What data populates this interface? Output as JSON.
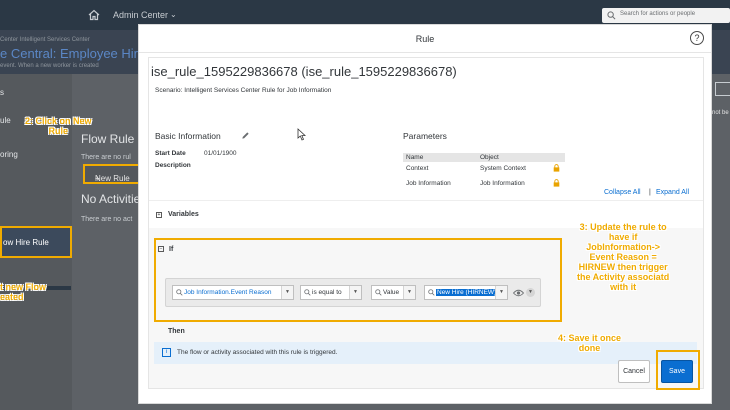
{
  "app": {
    "title": "Admin Center",
    "search_placeholder": "Search for actions or people",
    "breadcrumb": "Center Intelligent Services Center",
    "page_title": "e Central: Employee Hire",
    "subtitle": "event. When a new worker is created"
  },
  "sidebar": {
    "items": [
      "s",
      "ule",
      "oring",
      "ow Hire Rule"
    ]
  },
  "content": {
    "flow_rule_title": "Flow Rule",
    "no_rules_text": "There are no rul",
    "new_rule_button": "New Rule",
    "no_activities_title": "No Activitie",
    "no_activities_text": "There are no act",
    "right_cut_text": "not be"
  },
  "callouts": {
    "step2": "2: Click on New\nRule",
    "step1": "t new Flow\neated",
    "step3": "3: Update the rule to\nhave if\nJobInformation->\nEvent Reason =\nHIRNEW then trigger\nthe Activity associatd\nwith it",
    "step4": "4: Save it once\ndone"
  },
  "dialog": {
    "title": "Rule",
    "help": "?",
    "rule_title": "ise_rule_1595229836678 (ise_rule_1595229836678)",
    "scenario": "Scenario: Intelligent Services Center Rule for Job Information",
    "basic_info": {
      "title": "Basic Information",
      "start_date_label": "Start Date",
      "start_date_value": "01/01/1900",
      "description_label": "Description"
    },
    "parameters": {
      "title": "Parameters",
      "col_name": "Name",
      "col_object": "Object",
      "rows": [
        {
          "name": "Context",
          "object": "System Context"
        },
        {
          "name": "Job Information",
          "object": "Job Information"
        }
      ]
    },
    "collapse_all": "Collapse All",
    "expand_all": "Expand All",
    "link_separator": "|",
    "variables_label": "Variables",
    "if_label": "If",
    "condition": {
      "field": "Job Information.Event Reason",
      "operator": "is equal to",
      "value_type": "Value",
      "value": "New Hire (HIRNEW)"
    },
    "then_label": "Then",
    "message": "The flow or activity associated with this rule is triggered.",
    "cancel": "Cancel",
    "save": "Save"
  },
  "colors": {
    "accent": "#0a6ed1",
    "highlight": "#f0ab00",
    "shell": "#2b3845"
  }
}
